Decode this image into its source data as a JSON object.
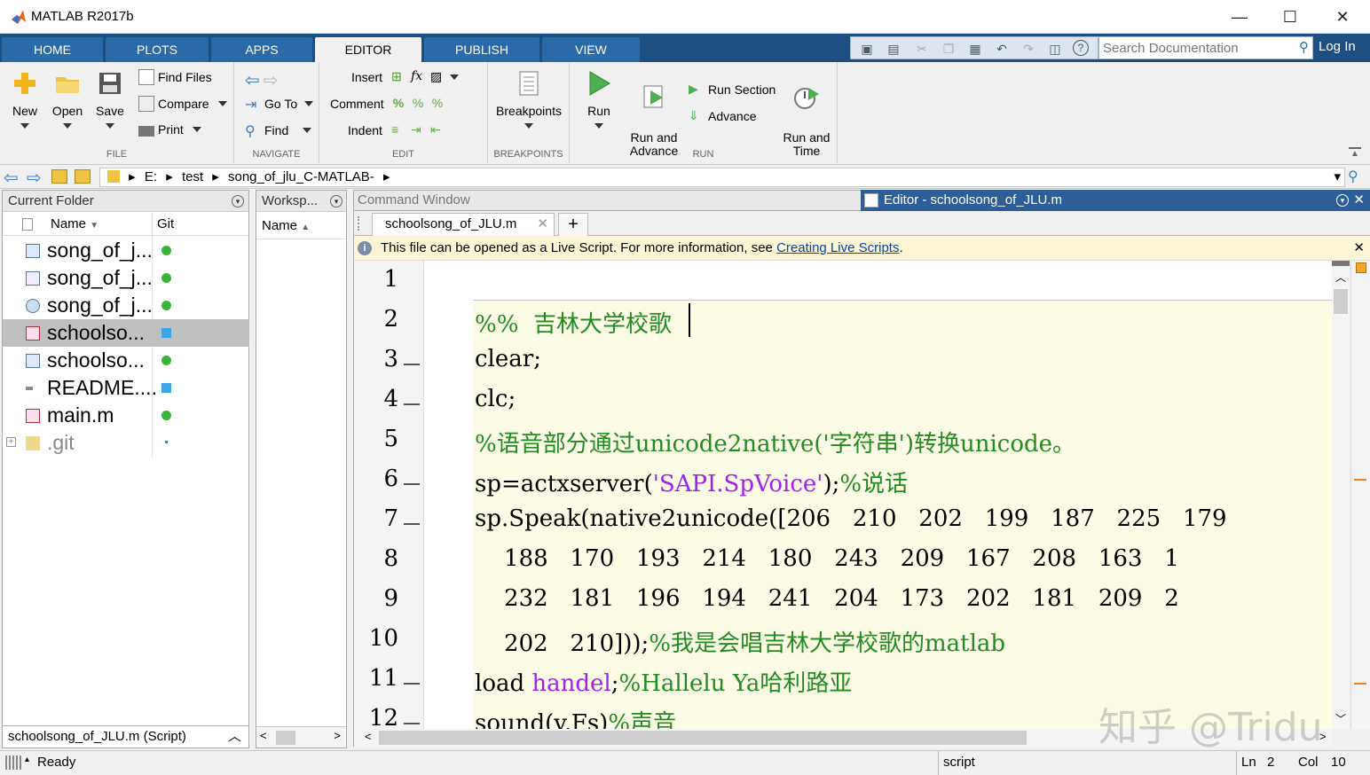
{
  "window": {
    "title": "MATLAB R2017b",
    "minimize": "—",
    "maximize": "☐",
    "close": "✕"
  },
  "tabs": [
    "HOME",
    "PLOTS",
    "APPS",
    "EDITOR",
    "PUBLISH",
    "VIEW"
  ],
  "active_tab": "EDITOR",
  "search": {
    "placeholder": "Search Documentation"
  },
  "login": "Log In",
  "ribbon": {
    "file": {
      "label": "FILE",
      "new": "New",
      "open": "Open",
      "save": "Save",
      "find_files": "Find Files",
      "compare": "Compare",
      "print": "Print"
    },
    "navigate": {
      "label": "NAVIGATE",
      "goto": "Go To",
      "find": "Find"
    },
    "edit": {
      "label": "EDIT",
      "insert": "Insert",
      "comment": "Comment",
      "indent": "Indent"
    },
    "breakpoints": {
      "label": "BREAKPOINTS",
      "breakpoints": "Breakpoints"
    },
    "run": {
      "label": "RUN",
      "run": "Run",
      "run_and_advance": "Run and\nAdvance",
      "run_section": "Run Section",
      "advance": "Advance",
      "run_and_time": "Run and\nTime"
    }
  },
  "address": {
    "parts": [
      "E:",
      "test",
      "song_of_jlu_C-MATLAB-"
    ]
  },
  "current_folder": {
    "title": "Current Folder",
    "col_name": "Name",
    "col_git": "Git",
    "files": [
      {
        "name": "song_of_j...",
        "git": "green"
      },
      {
        "name": "song_of_j...",
        "git": "green"
      },
      {
        "name": "song_of_j...",
        "git": "green"
      },
      {
        "name": "schoolso...",
        "git": "blue"
      },
      {
        "name": "schoolso...",
        "git": "green"
      },
      {
        "name": "README....",
        "git": "blue"
      },
      {
        "name": "main.m",
        "git": "green"
      },
      {
        "name": ".git",
        "git": "dot"
      }
    ],
    "details": "schoolsong_of_JLU.m  (Script)"
  },
  "workspace": {
    "title": "Worksp...",
    "col_name": "Name"
  },
  "command_window": {
    "title": "Command Window"
  },
  "editor": {
    "title": "Editor - schoolsong_of_JLU.m",
    "file_tab": "schoolsong_of_JLU.m",
    "info": "This file can be opened as a Live Script. For more information, see ",
    "info_link": "Creating Live Scripts",
    "info_end": ".",
    "lines": [
      {
        "n": "1",
        "dash": false,
        "parts": []
      },
      {
        "n": "2",
        "dash": false,
        "parts": [
          {
            "t": "%%  吉林大学校歌",
            "c": "cm"
          }
        ]
      },
      {
        "n": "3",
        "dash": true,
        "parts": [
          {
            "t": "clear;",
            "c": ""
          }
        ]
      },
      {
        "n": "4",
        "dash": true,
        "parts": [
          {
            "t": "clc;",
            "c": ""
          }
        ]
      },
      {
        "n": "5",
        "dash": false,
        "parts": [
          {
            "t": "%语音部分通过unicode2native('字符串')转换unicode。",
            "c": "cm"
          }
        ]
      },
      {
        "n": "6",
        "dash": true,
        "parts": [
          {
            "t": "sp=actxserver(",
            "c": ""
          },
          {
            "t": "'SAPI.SpVoice'",
            "c": "str"
          },
          {
            "t": ");",
            "c": ""
          },
          {
            "t": "%说话",
            "c": "cm"
          }
        ]
      },
      {
        "n": "7",
        "dash": true,
        "parts": [
          {
            "t": "sp.Speak(native2unicode([206   210   202   199   187   225   179",
            "c": ""
          }
        ]
      },
      {
        "n": "8",
        "dash": false,
        "parts": [
          {
            "t": "    188   170   193   214   180   243   209   167   208   163   1",
            "c": ""
          }
        ]
      },
      {
        "n": "9",
        "dash": false,
        "parts": [
          {
            "t": "    232   181   196   194   241   204   173   202   181   209   2",
            "c": ""
          }
        ]
      },
      {
        "n": "10",
        "dash": false,
        "parts": [
          {
            "t": "    202   210]));",
            "c": ""
          },
          {
            "t": "%我是会唱吉林大学校歌的matlab",
            "c": "cm"
          }
        ]
      },
      {
        "n": "11",
        "dash": true,
        "parts": [
          {
            "t": "load ",
            "c": ""
          },
          {
            "t": "handel",
            "c": "str"
          },
          {
            "t": ";",
            "c": ""
          },
          {
            "t": "%Hallelu Ya哈利路亚",
            "c": "cm"
          }
        ]
      },
      {
        "n": "12",
        "dash": true,
        "parts": [
          {
            "t": "sound(y,Fs)",
            "c": ""
          },
          {
            "t": "%声音",
            "c": "cm"
          }
        ]
      }
    ]
  },
  "watermark": "知乎 @Tridu",
  "status": {
    "ready": "Ready",
    "mode": "script",
    "ln_label": "Ln",
    "ln": "2",
    "col_label": "Col",
    "col": "10"
  }
}
